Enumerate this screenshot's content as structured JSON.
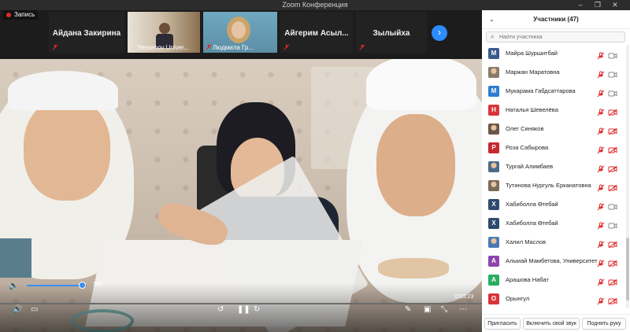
{
  "window": {
    "title": "Zoom Конференция"
  },
  "strip": {
    "tiles": [
      {
        "name": "Айдана Закирина"
      },
      {
        "name": "Yessenov Univer..."
      },
      {
        "name": "Людмила Гр..."
      },
      {
        "name": "Айгерим  Асыл..."
      },
      {
        "name": "Зылыйха"
      }
    ]
  },
  "video": {
    "recording_label": "Запись",
    "volume_value": "100",
    "volume_fraction": 0.92,
    "time": "0:03:23"
  },
  "participants": {
    "title": "Участники (47)",
    "search_placeholder": "Найти участника",
    "list": [
      {
        "initial": "М",
        "name": "Майра Шуршитбай",
        "color": "#3b5a8a",
        "photo": false
      },
      {
        "initial": "",
        "name": "Маржан Маратовна",
        "color": "#8a7a6a",
        "photo": true
      },
      {
        "initial": "М",
        "name": "Мукарама Габдсаттарова",
        "color": "#2d7dd2",
        "photo": false
      },
      {
        "initial": "Н",
        "name": "Наталья Шевелёва",
        "color": "#d9343a",
        "photo": false
      },
      {
        "initial": "",
        "name": "Олег Синяков",
        "color": "#6a5648",
        "photo": true
      },
      {
        "initial": "Р",
        "name": "Роза Сабырова",
        "color": "#c8282e",
        "photo": false
      },
      {
        "initial": "",
        "name": "Тургай Алимбаев",
        "color": "#4a6a8a",
        "photo": true
      },
      {
        "initial": "",
        "name": "Тутинова Нургуль Ерканатовна",
        "color": "#7a6a5a",
        "photo": true
      },
      {
        "initial": "Х",
        "name": "Хабиболла Өтебай",
        "color": "#2f4a6e",
        "photo": false
      },
      {
        "initial": "Х",
        "name": "Хабиболла Өтебай",
        "color": "#2f4a6e",
        "photo": false
      },
      {
        "initial": "",
        "name": "Халил Маслов",
        "color": "#4a7ab5",
        "photo": true
      },
      {
        "initial": "А",
        "name": "Алыиай Мамбетова, Университет ...",
        "color": "#8e44ad",
        "photo": false
      },
      {
        "initial": "А",
        "name": "Арашова Набат",
        "color": "#27ae60",
        "photo": false
      },
      {
        "initial": "О",
        "name": "Орынгул",
        "color": "#d9343a",
        "photo": false
      }
    ]
  },
  "footer": {
    "invite_label": "Пригласить",
    "unmute_label": "Включить свой звук",
    "raise_hand_label": "Поднять руку"
  },
  "colors": {
    "accent": "#2d8cff",
    "muted_red": "#e02828"
  }
}
